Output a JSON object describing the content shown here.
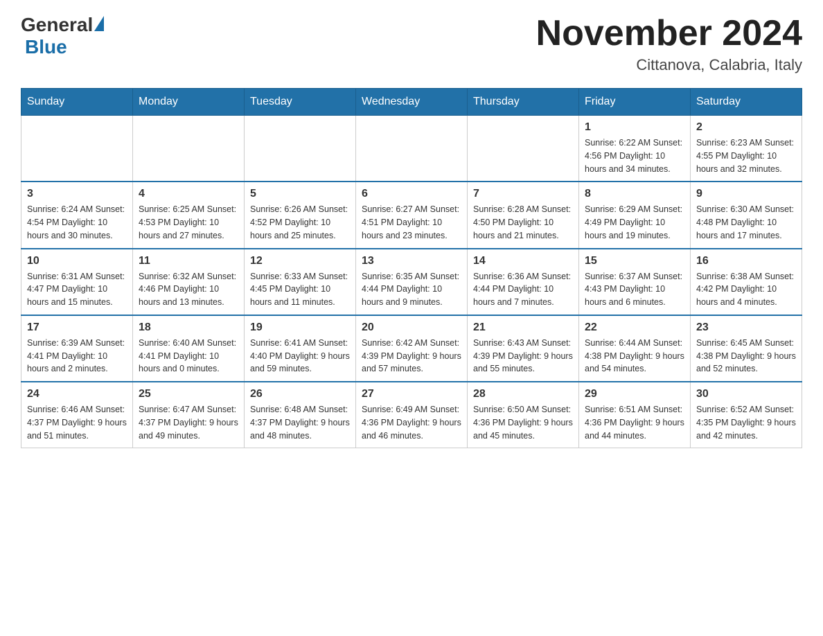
{
  "header": {
    "logo_general": "General",
    "logo_blue": "Blue",
    "month_year": "November 2024",
    "location": "Cittanova, Calabria, Italy"
  },
  "days_of_week": [
    "Sunday",
    "Monday",
    "Tuesday",
    "Wednesday",
    "Thursday",
    "Friday",
    "Saturday"
  ],
  "weeks": [
    [
      {
        "day": "",
        "info": ""
      },
      {
        "day": "",
        "info": ""
      },
      {
        "day": "",
        "info": ""
      },
      {
        "day": "",
        "info": ""
      },
      {
        "day": "",
        "info": ""
      },
      {
        "day": "1",
        "info": "Sunrise: 6:22 AM\nSunset: 4:56 PM\nDaylight: 10 hours\nand 34 minutes."
      },
      {
        "day": "2",
        "info": "Sunrise: 6:23 AM\nSunset: 4:55 PM\nDaylight: 10 hours\nand 32 minutes."
      }
    ],
    [
      {
        "day": "3",
        "info": "Sunrise: 6:24 AM\nSunset: 4:54 PM\nDaylight: 10 hours\nand 30 minutes."
      },
      {
        "day": "4",
        "info": "Sunrise: 6:25 AM\nSunset: 4:53 PM\nDaylight: 10 hours\nand 27 minutes."
      },
      {
        "day": "5",
        "info": "Sunrise: 6:26 AM\nSunset: 4:52 PM\nDaylight: 10 hours\nand 25 minutes."
      },
      {
        "day": "6",
        "info": "Sunrise: 6:27 AM\nSunset: 4:51 PM\nDaylight: 10 hours\nand 23 minutes."
      },
      {
        "day": "7",
        "info": "Sunrise: 6:28 AM\nSunset: 4:50 PM\nDaylight: 10 hours\nand 21 minutes."
      },
      {
        "day": "8",
        "info": "Sunrise: 6:29 AM\nSunset: 4:49 PM\nDaylight: 10 hours\nand 19 minutes."
      },
      {
        "day": "9",
        "info": "Sunrise: 6:30 AM\nSunset: 4:48 PM\nDaylight: 10 hours\nand 17 minutes."
      }
    ],
    [
      {
        "day": "10",
        "info": "Sunrise: 6:31 AM\nSunset: 4:47 PM\nDaylight: 10 hours\nand 15 minutes."
      },
      {
        "day": "11",
        "info": "Sunrise: 6:32 AM\nSunset: 4:46 PM\nDaylight: 10 hours\nand 13 minutes."
      },
      {
        "day": "12",
        "info": "Sunrise: 6:33 AM\nSunset: 4:45 PM\nDaylight: 10 hours\nand 11 minutes."
      },
      {
        "day": "13",
        "info": "Sunrise: 6:35 AM\nSunset: 4:44 PM\nDaylight: 10 hours\nand 9 minutes."
      },
      {
        "day": "14",
        "info": "Sunrise: 6:36 AM\nSunset: 4:44 PM\nDaylight: 10 hours\nand 7 minutes."
      },
      {
        "day": "15",
        "info": "Sunrise: 6:37 AM\nSunset: 4:43 PM\nDaylight: 10 hours\nand 6 minutes."
      },
      {
        "day": "16",
        "info": "Sunrise: 6:38 AM\nSunset: 4:42 PM\nDaylight: 10 hours\nand 4 minutes."
      }
    ],
    [
      {
        "day": "17",
        "info": "Sunrise: 6:39 AM\nSunset: 4:41 PM\nDaylight: 10 hours\nand 2 minutes."
      },
      {
        "day": "18",
        "info": "Sunrise: 6:40 AM\nSunset: 4:41 PM\nDaylight: 10 hours\nand 0 minutes."
      },
      {
        "day": "19",
        "info": "Sunrise: 6:41 AM\nSunset: 4:40 PM\nDaylight: 9 hours\nand 59 minutes."
      },
      {
        "day": "20",
        "info": "Sunrise: 6:42 AM\nSunset: 4:39 PM\nDaylight: 9 hours\nand 57 minutes."
      },
      {
        "day": "21",
        "info": "Sunrise: 6:43 AM\nSunset: 4:39 PM\nDaylight: 9 hours\nand 55 minutes."
      },
      {
        "day": "22",
        "info": "Sunrise: 6:44 AM\nSunset: 4:38 PM\nDaylight: 9 hours\nand 54 minutes."
      },
      {
        "day": "23",
        "info": "Sunrise: 6:45 AM\nSunset: 4:38 PM\nDaylight: 9 hours\nand 52 minutes."
      }
    ],
    [
      {
        "day": "24",
        "info": "Sunrise: 6:46 AM\nSunset: 4:37 PM\nDaylight: 9 hours\nand 51 minutes."
      },
      {
        "day": "25",
        "info": "Sunrise: 6:47 AM\nSunset: 4:37 PM\nDaylight: 9 hours\nand 49 minutes."
      },
      {
        "day": "26",
        "info": "Sunrise: 6:48 AM\nSunset: 4:37 PM\nDaylight: 9 hours\nand 48 minutes."
      },
      {
        "day": "27",
        "info": "Sunrise: 6:49 AM\nSunset: 4:36 PM\nDaylight: 9 hours\nand 46 minutes."
      },
      {
        "day": "28",
        "info": "Sunrise: 6:50 AM\nSunset: 4:36 PM\nDaylight: 9 hours\nand 45 minutes."
      },
      {
        "day": "29",
        "info": "Sunrise: 6:51 AM\nSunset: 4:36 PM\nDaylight: 9 hours\nand 44 minutes."
      },
      {
        "day": "30",
        "info": "Sunrise: 6:52 AM\nSunset: 4:35 PM\nDaylight: 9 hours\nand 42 minutes."
      }
    ]
  ]
}
